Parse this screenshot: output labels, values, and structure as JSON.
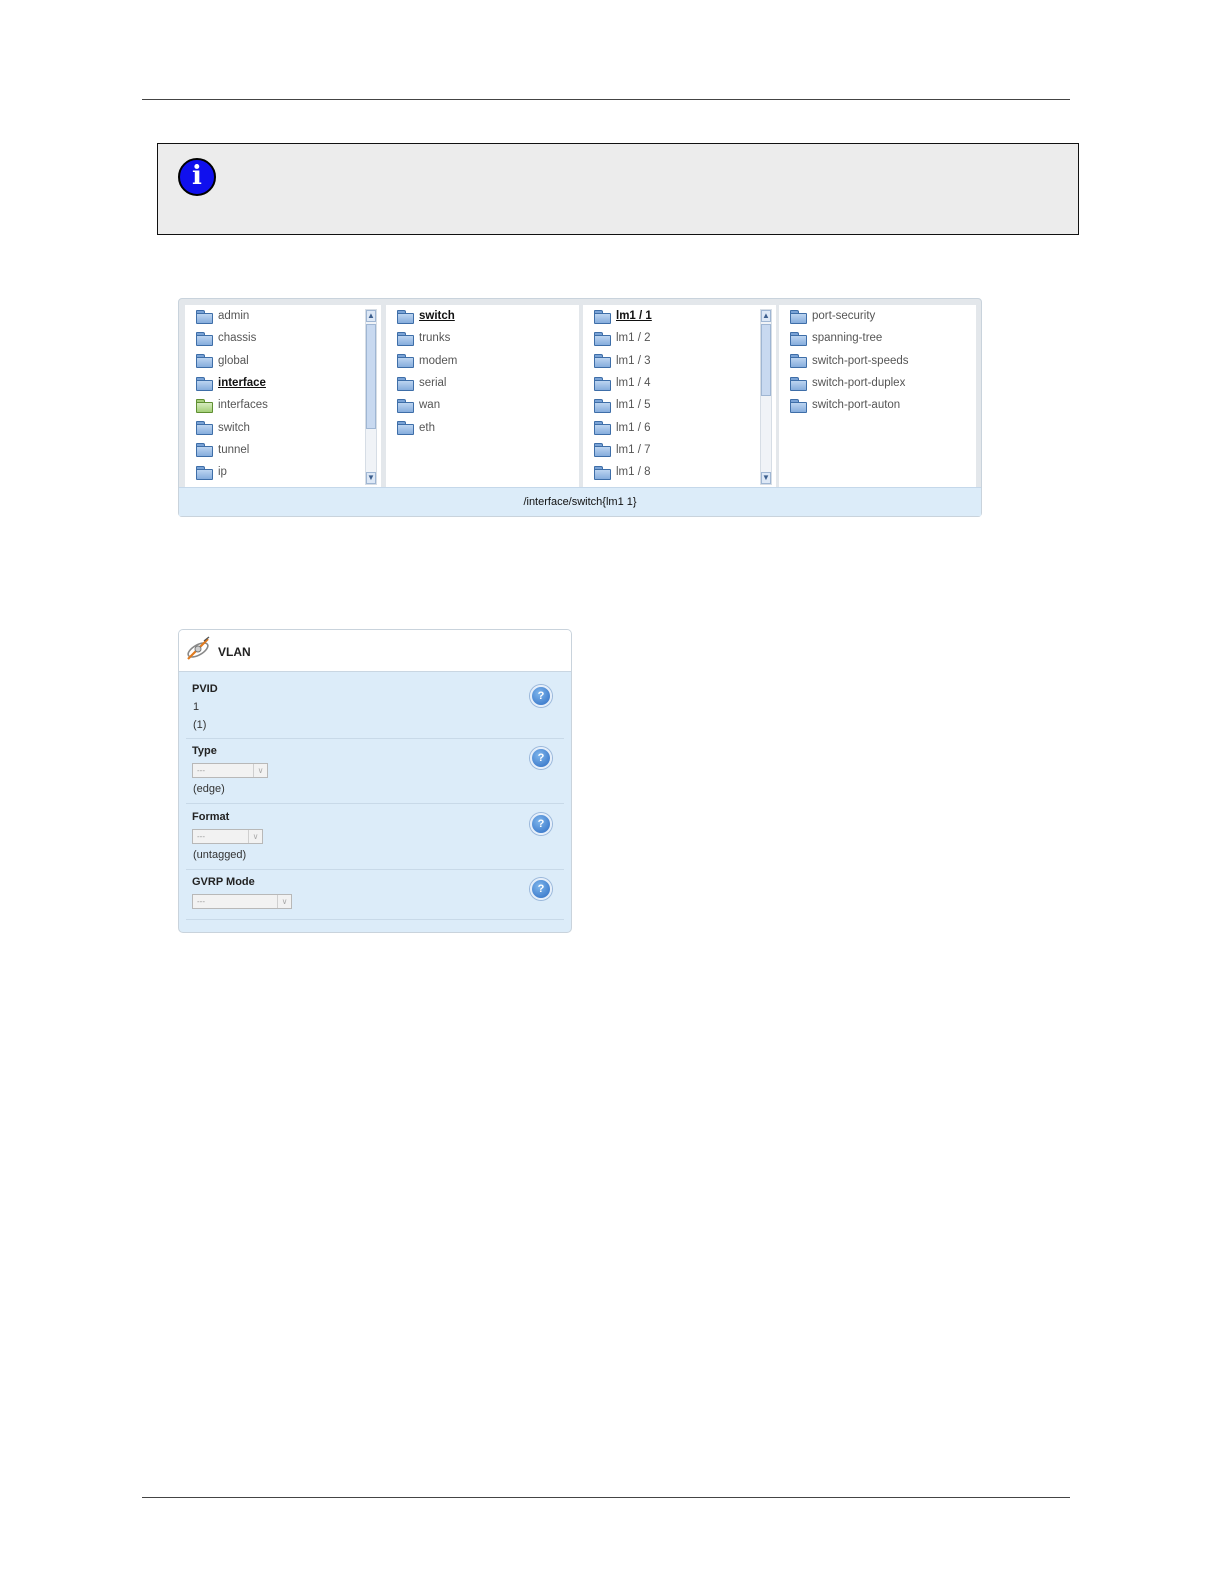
{
  "browser": {
    "columns": [
      {
        "items": [
          {
            "label": "admin",
            "icon": "folder-icon"
          },
          {
            "label": "chassis",
            "icon": "folder-icon"
          },
          {
            "label": "global",
            "icon": "folder-icon"
          },
          {
            "label": "interface",
            "icon": "folder-open-icon",
            "selected": true
          },
          {
            "label": "interfaces",
            "icon": "folder-green-icon"
          },
          {
            "label": "switch",
            "icon": "folder-icon"
          },
          {
            "label": "tunnel",
            "icon": "folder-icon"
          },
          {
            "label": "ip",
            "icon": "folder-icon"
          }
        ]
      },
      {
        "items": [
          {
            "label": "switch",
            "icon": "folder-open-icon",
            "selected": true
          },
          {
            "label": "trunks",
            "icon": "folder-icon"
          },
          {
            "label": "modem",
            "icon": "folder-icon"
          },
          {
            "label": "serial",
            "icon": "folder-icon"
          },
          {
            "label": "wan",
            "icon": "folder-icon"
          },
          {
            "label": "eth",
            "icon": "folder-icon"
          }
        ]
      },
      {
        "items": [
          {
            "label": "lm1 / 1",
            "icon": "folder-open-icon",
            "selected": true
          },
          {
            "label": "lm1 / 2",
            "icon": "folder-icon"
          },
          {
            "label": "lm1 / 3",
            "icon": "folder-icon"
          },
          {
            "label": "lm1 / 4",
            "icon": "folder-icon"
          },
          {
            "label": "lm1 / 5",
            "icon": "folder-icon"
          },
          {
            "label": "lm1 / 6",
            "icon": "folder-icon"
          },
          {
            "label": "lm1 / 7",
            "icon": "folder-icon"
          },
          {
            "label": "lm1 / 8",
            "icon": "folder-icon"
          }
        ]
      },
      {
        "items": [
          {
            "label": "port-security",
            "icon": "folder-icon"
          },
          {
            "label": "spanning-tree",
            "icon": "folder-icon"
          },
          {
            "label": "switch-port-speeds",
            "icon": "folder-icon"
          },
          {
            "label": "switch-port-duplex",
            "icon": "folder-icon"
          },
          {
            "label": "switch-port-auton",
            "icon": "folder-icon"
          }
        ]
      }
    ],
    "path": "/interface/switch{lm1 1}"
  },
  "vlan": {
    "title": "VLAN",
    "icon": "vlan-satellite-icon",
    "fields": {
      "pvid": {
        "label": "PVID",
        "value": "1",
        "default": "(1)"
      },
      "type": {
        "label": "Type",
        "selected": "---",
        "default": "(edge)"
      },
      "format": {
        "label": "Format",
        "selected": "---",
        "default": "(untagged)"
      },
      "gvrp": {
        "label": "GVRP Mode",
        "selected": "---"
      }
    },
    "help_glyph": "?"
  },
  "note": {
    "icon": "info-icon",
    "glyph": "i"
  },
  "colors": {
    "accent": "#1010ee",
    "panel": "#dcecf9",
    "help": "#2c6cc3"
  }
}
